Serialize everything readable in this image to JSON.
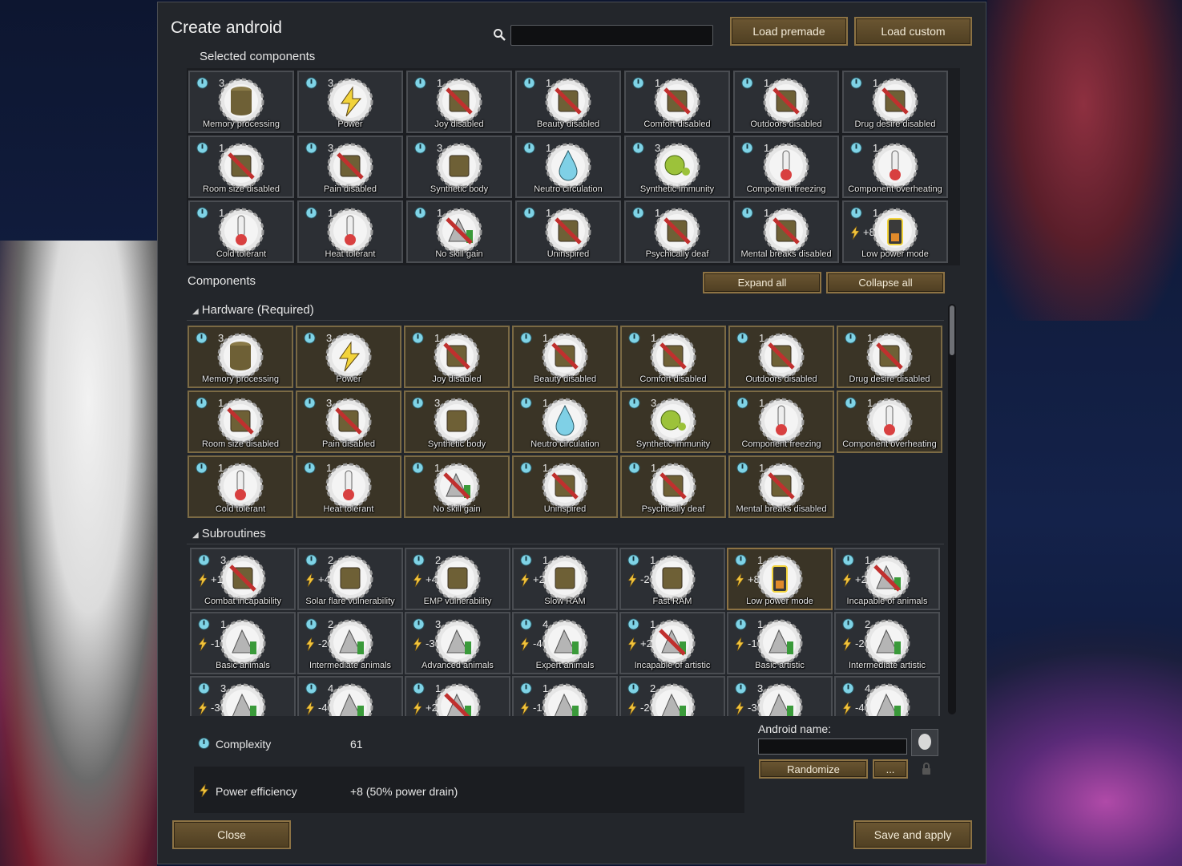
{
  "window": {
    "title": "Create android",
    "search": {
      "value": "",
      "placeholder": ""
    },
    "load_premade": "Load premade",
    "load_custom": "Load custom",
    "selected_label": "Selected components",
    "components_label": "Components",
    "expand_all": "Expand all",
    "collapse_all": "Collapse all",
    "close": "Close",
    "save_apply": "Save and apply"
  },
  "colors": {
    "accent": "#8d7344",
    "complexity_icon": "#7fd3e6",
    "power_icon": "#f2c33b"
  },
  "selected": [
    {
      "cpx": "3",
      "label": "Memory processing",
      "icon": "disk-stack-icon"
    },
    {
      "cpx": "3",
      "label": "Power",
      "icon": "lightning-icon"
    },
    {
      "cpx": "1",
      "label": "Joy disabled",
      "icon": "no-joy-icon"
    },
    {
      "cpx": "1",
      "label": "Beauty disabled",
      "icon": "no-beauty-icon"
    },
    {
      "cpx": "1",
      "label": "Comfort disabled",
      "icon": "no-comfort-icon"
    },
    {
      "cpx": "1",
      "label": "Outdoors disabled",
      "icon": "no-tree-icon"
    },
    {
      "cpx": "1",
      "label": "Drug desire disabled",
      "icon": "no-drug-icon"
    },
    {
      "cpx": "1",
      "label": "Room size disabled",
      "icon": "no-room-icon"
    },
    {
      "cpx": "3",
      "label": "Pain disabled",
      "icon": "no-pain-icon"
    },
    {
      "cpx": "3",
      "label": "Synthetic body",
      "icon": "body-icon"
    },
    {
      "cpx": "1",
      "label": "Neutro circulation",
      "icon": "droplet-icon"
    },
    {
      "cpx": "3",
      "label": "Synthetic immunity",
      "icon": "germ-icon"
    },
    {
      "cpx": "1",
      "label": "Component freezing",
      "icon": "thermometer-cold-icon"
    },
    {
      "cpx": "1",
      "label": "Component overheating",
      "icon": "thermometer-hot-icon"
    },
    {
      "cpx": "1",
      "label": "Cold tolerant",
      "icon": "cold-tolerant-icon"
    },
    {
      "cpx": "1",
      "label": "Heat tolerant",
      "icon": "heat-tolerant-icon"
    },
    {
      "cpx": "1",
      "label": "No skill gain",
      "icon": "no-skill-icon"
    },
    {
      "cpx": "1",
      "label": "Uninspired",
      "icon": "no-inspiration-icon"
    },
    {
      "cpx": "1",
      "label": "Psychically deaf",
      "icon": "no-psychic-icon"
    },
    {
      "cpx": "1",
      "label": "Mental breaks disabled",
      "icon": "no-break-icon"
    },
    {
      "cpx": "1",
      "pw": "+8",
      "label": "Low power mode",
      "icon": "battery-icon"
    }
  ],
  "hardware": {
    "title": "Hardware (Required)",
    "items": [
      {
        "cpx": "3",
        "label": "Memory processing",
        "icon": "disk-stack-icon"
      },
      {
        "cpx": "3",
        "label": "Power",
        "icon": "lightning-icon"
      },
      {
        "cpx": "1",
        "label": "Joy disabled",
        "icon": "no-joy-icon"
      },
      {
        "cpx": "1",
        "label": "Beauty disabled",
        "icon": "no-beauty-icon"
      },
      {
        "cpx": "1",
        "label": "Comfort disabled",
        "icon": "no-comfort-icon"
      },
      {
        "cpx": "1",
        "label": "Outdoors disabled",
        "icon": "no-tree-icon"
      },
      {
        "cpx": "1",
        "label": "Drug desire disabled",
        "icon": "no-drug-icon"
      },
      {
        "cpx": "1",
        "label": "Room size disabled",
        "icon": "no-room-icon"
      },
      {
        "cpx": "3",
        "label": "Pain disabled",
        "icon": "no-pain-icon"
      },
      {
        "cpx": "3",
        "label": "Synthetic body",
        "icon": "body-icon"
      },
      {
        "cpx": "1",
        "label": "Neutro circulation",
        "icon": "droplet-icon"
      },
      {
        "cpx": "3",
        "label": "Synthetic immunity",
        "icon": "germ-icon"
      },
      {
        "cpx": "1",
        "label": "Component freezing",
        "icon": "thermometer-cold-icon"
      },
      {
        "cpx": "1",
        "label": "Component overheating",
        "icon": "thermometer-hot-icon"
      },
      {
        "cpx": "1",
        "label": "Cold tolerant",
        "icon": "cold-tolerant-icon"
      },
      {
        "cpx": "1",
        "label": "Heat tolerant",
        "icon": "heat-tolerant-icon"
      },
      {
        "cpx": "1",
        "label": "No skill gain",
        "icon": "no-skill-icon"
      },
      {
        "cpx": "1",
        "label": "Uninspired",
        "icon": "no-inspiration-icon"
      },
      {
        "cpx": "1",
        "label": "Psychically deaf",
        "icon": "no-psychic-icon"
      },
      {
        "cpx": "1",
        "label": "Mental breaks disabled",
        "icon": "no-break-icon"
      }
    ]
  },
  "subroutines": {
    "title": "Subroutines",
    "items": [
      {
        "cpx": "3",
        "pw": "+12",
        "label": "Combat incapability",
        "icon": "no-combat-icon"
      },
      {
        "cpx": "2",
        "pw": "+4",
        "label": "Solar flare vulnerability",
        "icon": "solar-flare-icon"
      },
      {
        "cpx": "2",
        "pw": "+4",
        "label": "EMP vulnerability",
        "icon": "emp-icon"
      },
      {
        "cpx": "1",
        "pw": "+2",
        "label": "Slow RAM",
        "icon": "slow-ram-icon"
      },
      {
        "cpx": "1",
        "pw": "-2",
        "label": "Fast RAM",
        "icon": "fast-ram-icon"
      },
      {
        "cpx": "1",
        "pw": "+8",
        "label": "Low power mode",
        "icon": "battery-icon",
        "selected": true
      },
      {
        "cpx": "1",
        "pw": "+2",
        "label": "Incapable of animals",
        "icon": "no-animals-icon"
      },
      {
        "cpx": "1",
        "pw": "-1",
        "label": "Basic animals",
        "icon": "animals-icon"
      },
      {
        "cpx": "2",
        "pw": "-2",
        "label": "Intermediate animals",
        "icon": "animals-icon"
      },
      {
        "cpx": "3",
        "pw": "-3",
        "label": "Advanced animals",
        "icon": "animals-icon"
      },
      {
        "cpx": "4",
        "pw": "-4",
        "label": "Expert animals",
        "icon": "animals-icon"
      },
      {
        "cpx": "1",
        "pw": "+2",
        "label": "Incapable of artistic",
        "icon": "no-artistic-icon"
      },
      {
        "cpx": "1",
        "pw": "-1",
        "label": "Basic artistic",
        "icon": "artistic-icon"
      },
      {
        "cpx": "2",
        "pw": "-2",
        "label": "Intermediate artistic",
        "icon": "artistic-icon"
      },
      {
        "cpx": "3",
        "pw": "-3",
        "label": "",
        "icon": "artistic-icon"
      },
      {
        "cpx": "4",
        "pw": "-4",
        "label": "",
        "icon": "artistic-icon"
      },
      {
        "cpx": "1",
        "pw": "+2",
        "label": "",
        "icon": "no-skill-icon"
      },
      {
        "cpx": "1",
        "pw": "-1",
        "label": "",
        "icon": "skill-icon"
      },
      {
        "cpx": "2",
        "pw": "-2",
        "label": "",
        "icon": "skill-icon"
      },
      {
        "cpx": "3",
        "pw": "-3",
        "label": "",
        "icon": "skill-icon"
      },
      {
        "cpx": "4",
        "pw": "-4",
        "label": "",
        "icon": "skill-icon"
      }
    ]
  },
  "stats": {
    "complexity_label": "Complexity",
    "complexity_value": "61",
    "power_label": "Power efficiency",
    "power_value": "+8 (50% power drain)"
  },
  "android_name": {
    "label": "Android name:",
    "value": "",
    "randomize": "Randomize",
    "more": "..."
  }
}
